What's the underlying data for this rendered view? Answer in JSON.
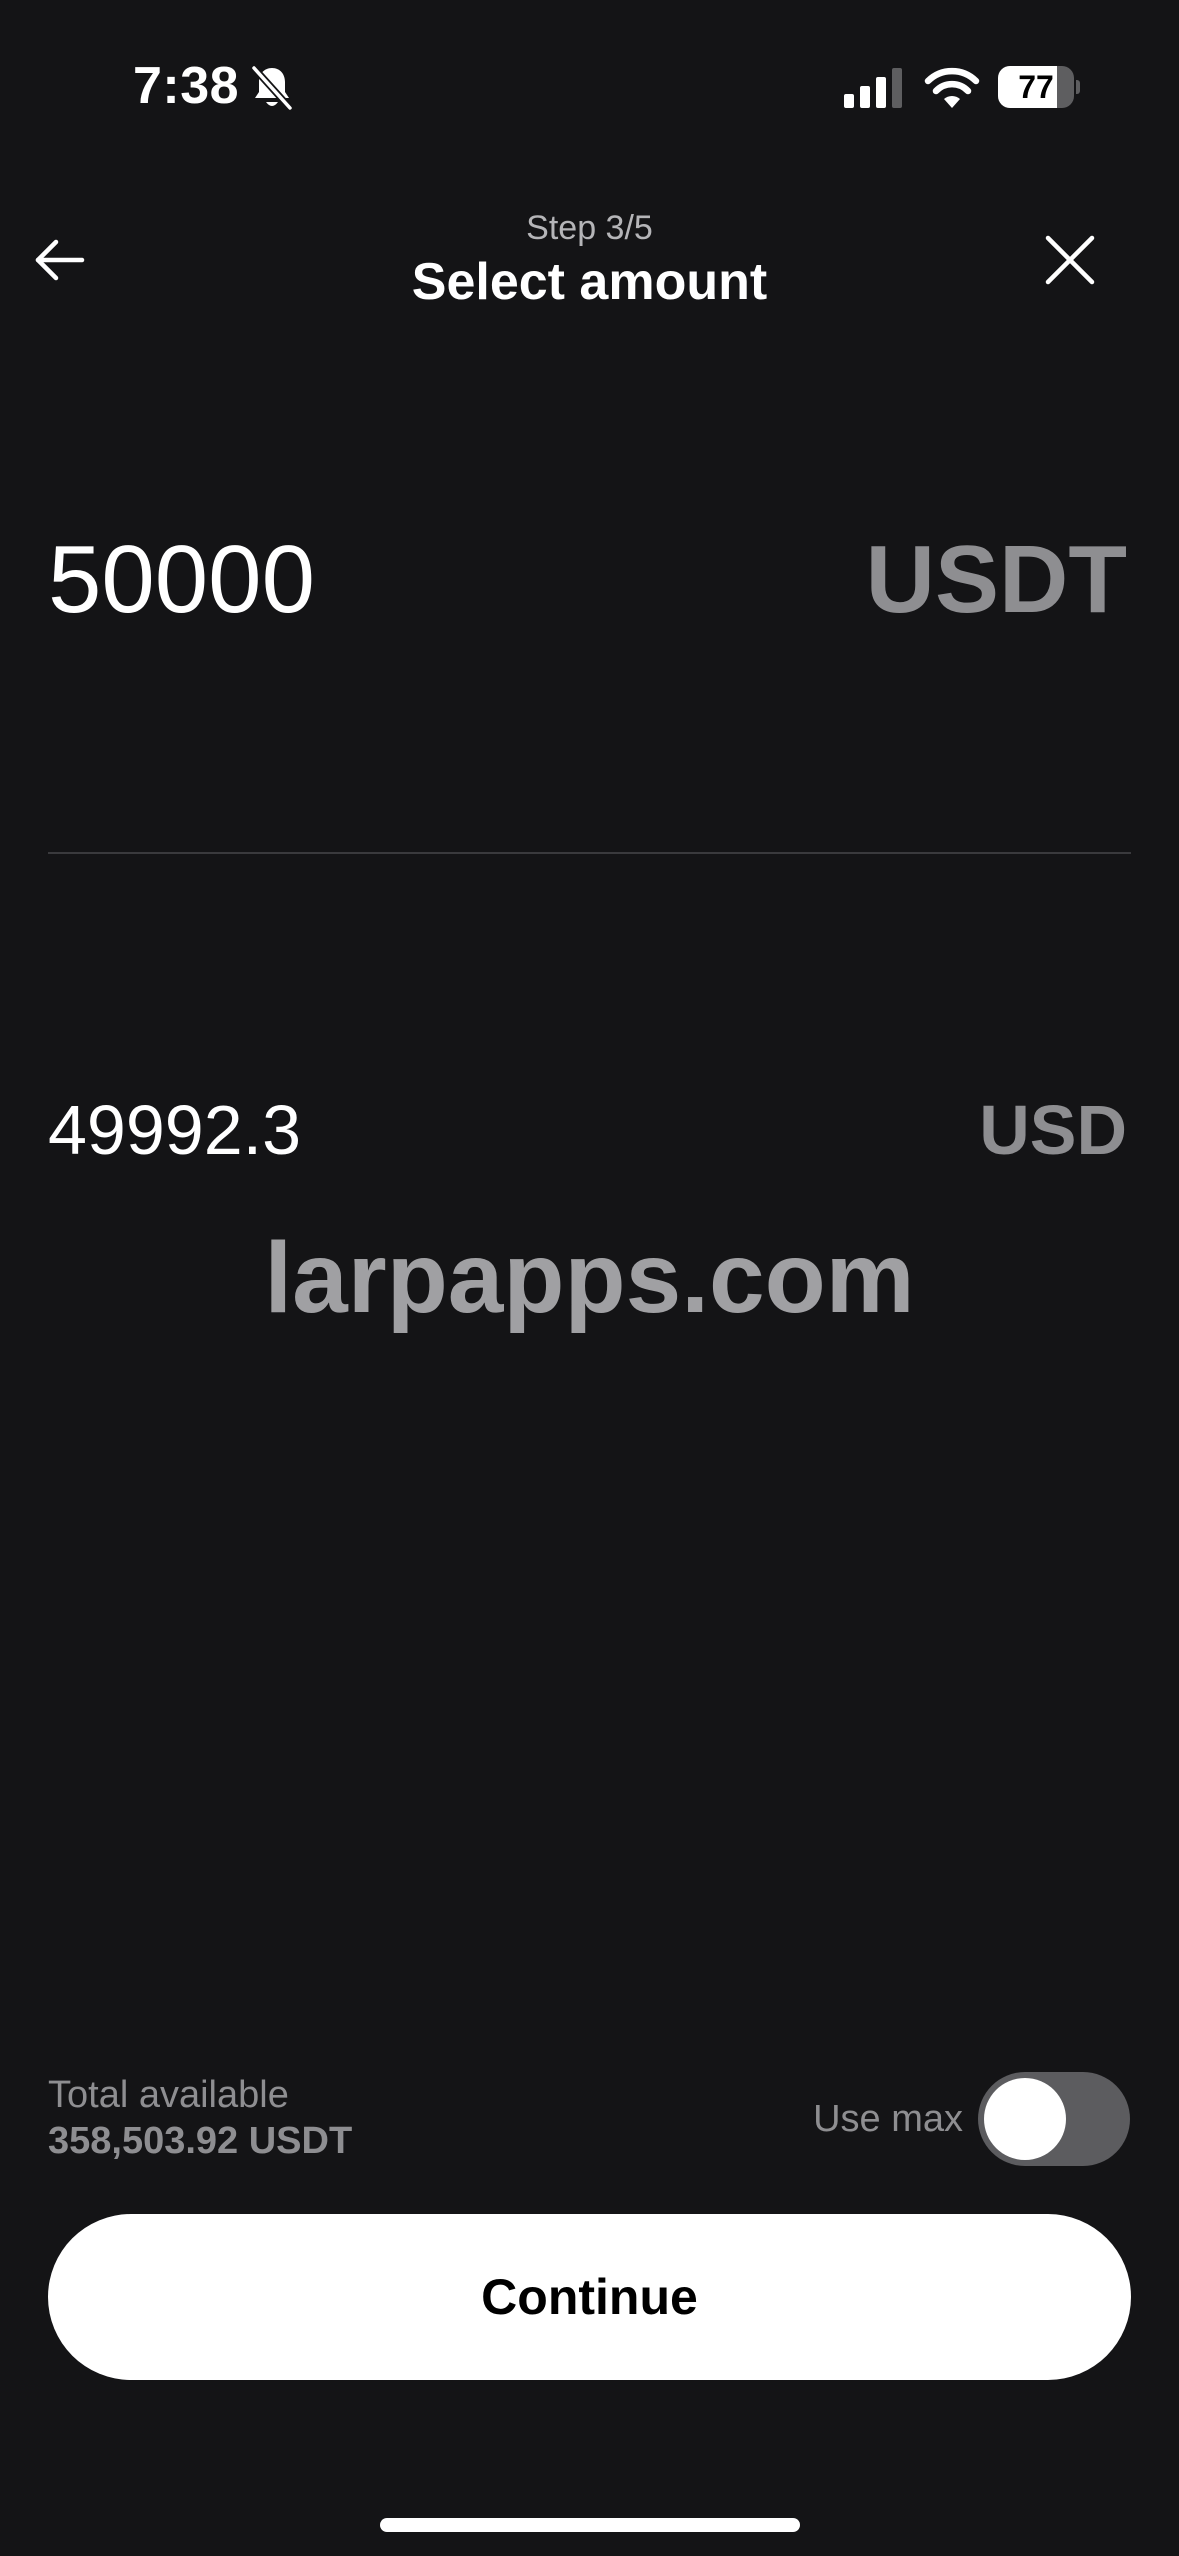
{
  "status_bar": {
    "time": "7:38",
    "battery_percent": "77",
    "battery_level": 0.77,
    "icons": [
      "bell-off-icon",
      "signal-icon",
      "wifi-icon",
      "battery-icon"
    ]
  },
  "header": {
    "step": "Step 3/5",
    "title": "Select amount",
    "back_icon": "arrow-left-icon",
    "close_icon": "close-icon"
  },
  "amount": {
    "value": "50000",
    "currency": "USDT"
  },
  "conversion": {
    "value": "49992.3",
    "currency": "USD"
  },
  "watermark": "larpapps.com",
  "available": {
    "label": "Total available",
    "value": "358,503.92 USDT"
  },
  "use_max": {
    "label": "Use max",
    "enabled": false
  },
  "continue_label": "Continue",
  "colors": {
    "background": "#141416",
    "primary_text": "#ffffff",
    "muted_text": "#8e8e91",
    "button_bg": "#ffffff",
    "button_text": "#000000",
    "toggle_off": "#5c5c5f"
  }
}
